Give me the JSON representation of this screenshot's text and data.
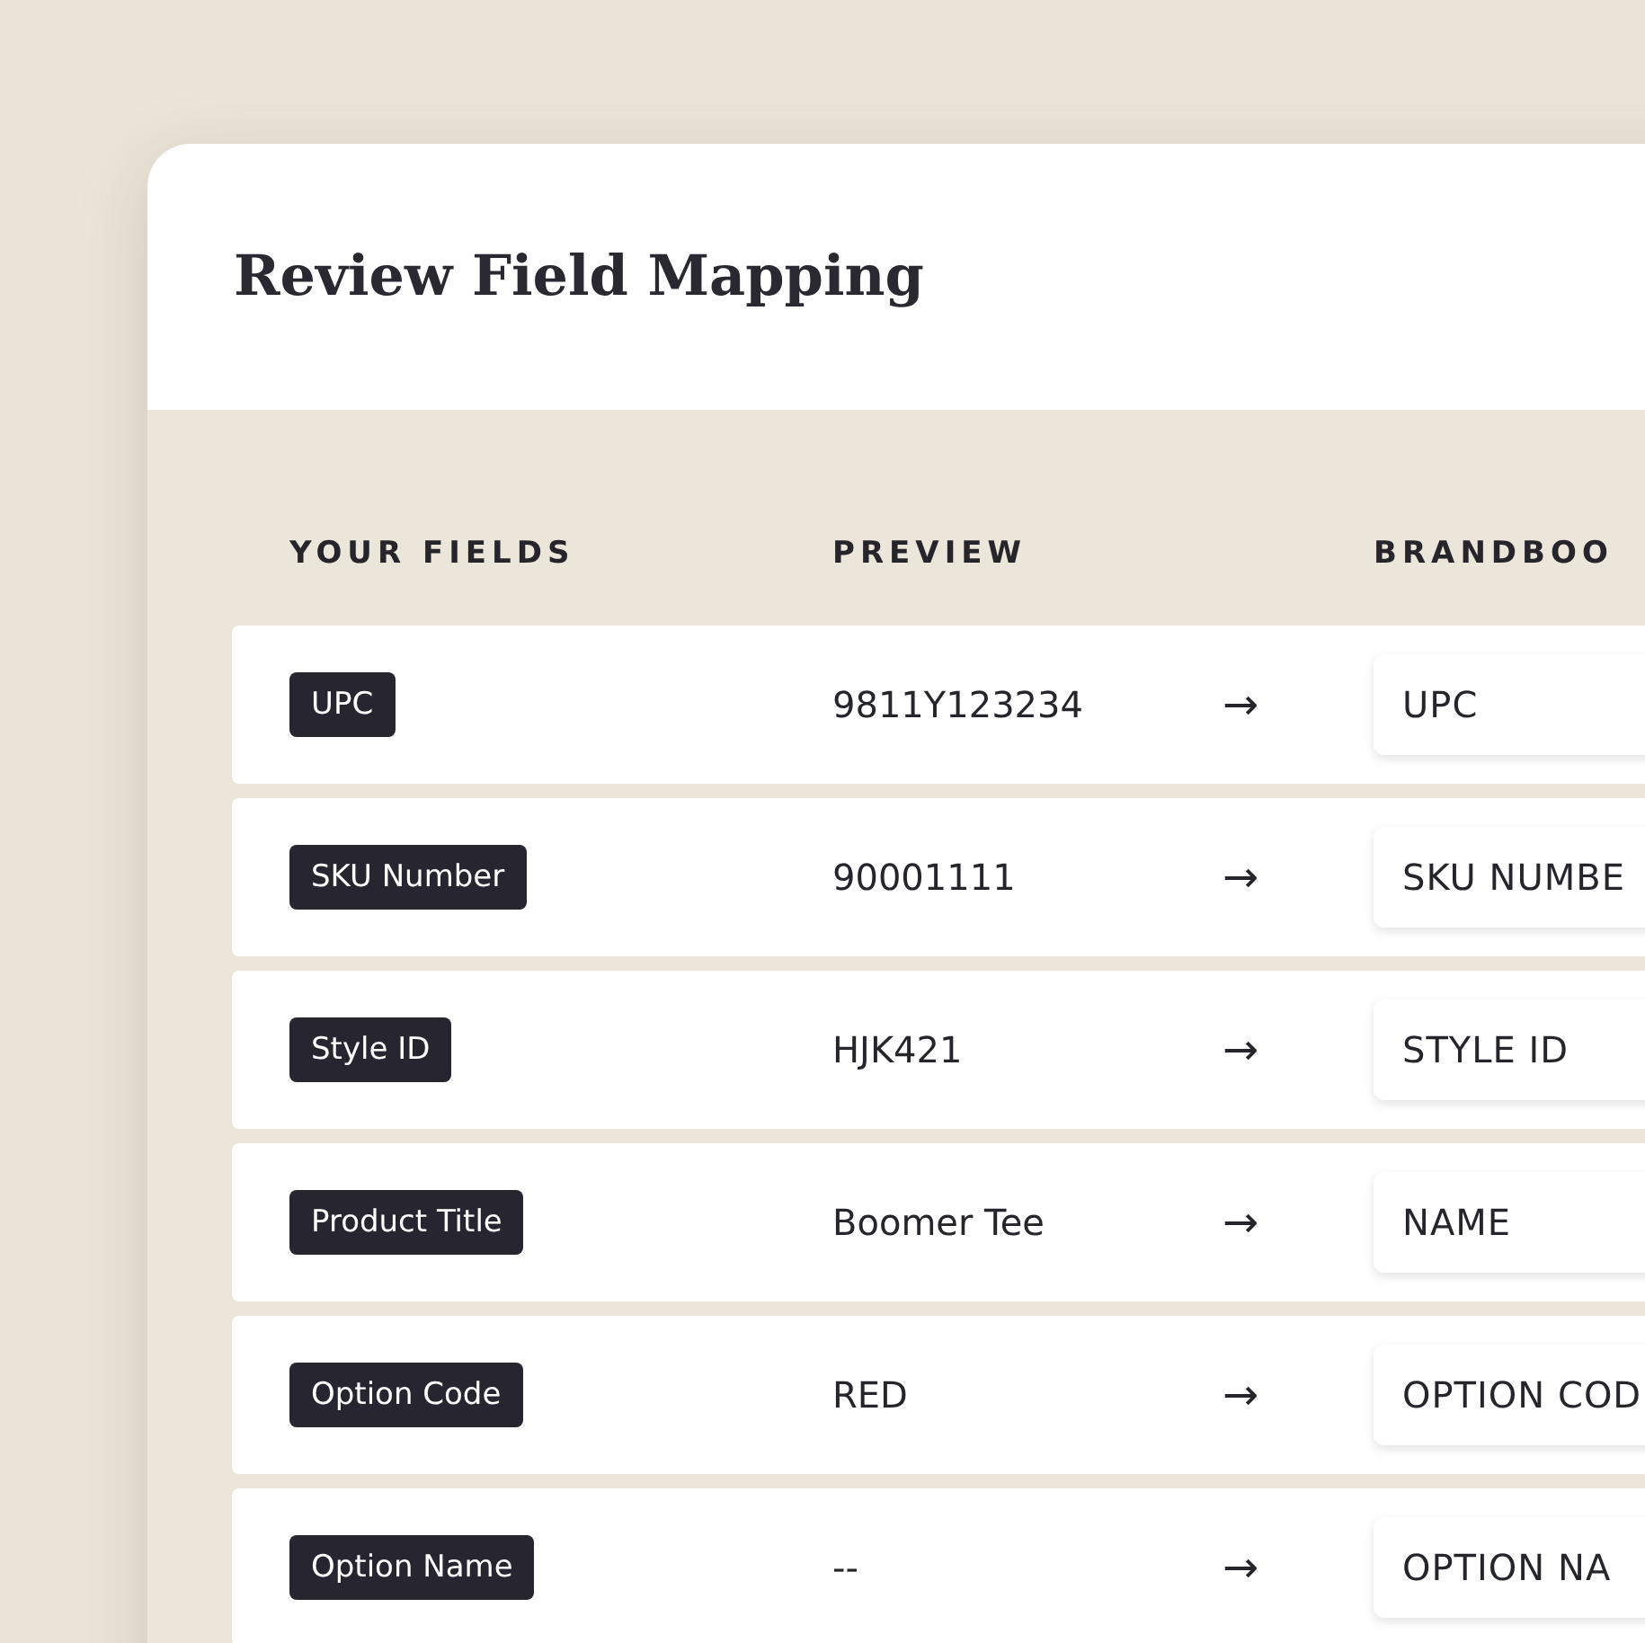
{
  "title": "Review Field Mapping",
  "columns": [
    "YOUR FIELDS",
    "PREVIEW",
    "BRANDBOO"
  ],
  "rows": [
    {
      "field": "UPC",
      "preview": "9811Y123234",
      "arrow": "→",
      "target": "UPC"
    },
    {
      "field": "SKU Number",
      "preview": "90001111",
      "arrow": "→",
      "target": "SKU NUMBE"
    },
    {
      "field": "Style ID",
      "preview": "HJK421",
      "arrow": "→",
      "target": "STYLE ID"
    },
    {
      "field": "Product Title",
      "preview": "Boomer Tee",
      "arrow": "→",
      "target": "NAME"
    },
    {
      "field": "Option Code",
      "preview": "RED",
      "arrow": "→",
      "target": "OPTION COD"
    },
    {
      "field": "Option Name",
      "preview": "--",
      "arrow": "→",
      "target": "OPTION NA"
    }
  ]
}
